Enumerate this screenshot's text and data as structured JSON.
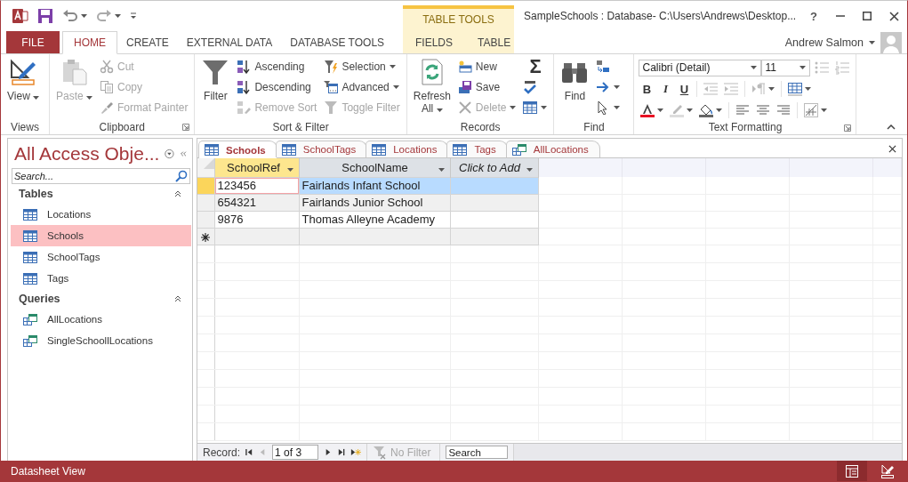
{
  "window": {
    "title": "SampleSchools : Database- C:\\Users\\Andrews\\Desktop...",
    "help": "?"
  },
  "contextual_group": {
    "label": "TABLE TOOLS"
  },
  "ribbon_tabs": [
    {
      "label": "FILE",
      "kind": "file",
      "selected": false
    },
    {
      "label": "HOME",
      "kind": "normal",
      "selected": true
    },
    {
      "label": "CREATE",
      "kind": "normal",
      "selected": false
    },
    {
      "label": "EXTERNAL DATA",
      "kind": "normal",
      "selected": false
    },
    {
      "label": "DATABASE TOOLS",
      "kind": "normal",
      "selected": false
    },
    {
      "label": "FIELDS",
      "kind": "contextual",
      "selected": false
    },
    {
      "label": "TABLE",
      "kind": "contextual",
      "selected": false
    }
  ],
  "account": {
    "name": "Andrew Salmon"
  },
  "ribbon": {
    "groups": [
      {
        "label": "Views",
        "commands": [
          {
            "label": "View",
            "disabled": false,
            "dropdown": true
          }
        ]
      },
      {
        "label": "Clipboard",
        "launcher": true,
        "commands": [
          {
            "label": "Paste",
            "disabled": true,
            "dropdown": true
          },
          {
            "label": "Cut",
            "disabled": true,
            "dropdown": false
          },
          {
            "label": "Copy",
            "disabled": true,
            "dropdown": false
          },
          {
            "label": "Format Painter",
            "disabled": true,
            "dropdown": false
          }
        ]
      },
      {
        "label": "Sort & Filter",
        "commands": [
          {
            "label": "Filter",
            "disabled": false,
            "dropdown": false
          },
          {
            "label": "Ascending",
            "disabled": false,
            "dropdown": false
          },
          {
            "label": "Descending",
            "disabled": false,
            "dropdown": false
          },
          {
            "label": "Remove Sort",
            "disabled": true,
            "dropdown": false
          },
          {
            "label": "Selection",
            "disabled": false,
            "dropdown": true
          },
          {
            "label": "Advanced",
            "disabled": false,
            "dropdown": true
          },
          {
            "label": "Toggle Filter",
            "disabled": true,
            "dropdown": false
          }
        ]
      },
      {
        "label": "Records",
        "totals": "Σ",
        "commands": [
          {
            "label": "Refresh All",
            "disabled": false,
            "dropdown": true
          },
          {
            "label": "New",
            "disabled": false,
            "dropdown": false
          },
          {
            "label": "Save",
            "disabled": false,
            "dropdown": false
          },
          {
            "label": "Delete",
            "disabled": true,
            "dropdown": true
          }
        ]
      },
      {
        "label": "Find",
        "commands": [
          {
            "label": "Find",
            "disabled": false,
            "dropdown": false
          }
        ]
      },
      {
        "label": "Text Formatting",
        "launcher": true,
        "font": "Calibri (Detail)",
        "size": "11",
        "styles": [
          "B",
          "I",
          "U"
        ]
      }
    ]
  },
  "nav_pane": {
    "title": "All Access Obje...",
    "search_placeholder": "Search...",
    "groups": [
      {
        "label": "Tables",
        "expanded": true,
        "items": [
          {
            "label": "Locations",
            "kind": "table",
            "selected": false
          },
          {
            "label": "Schools",
            "kind": "table",
            "selected": true
          },
          {
            "label": "SchoolTags",
            "kind": "table",
            "selected": false
          },
          {
            "label": "Tags",
            "kind": "table",
            "selected": false
          }
        ]
      },
      {
        "label": "Queries",
        "expanded": true,
        "items": [
          {
            "label": "AllLocations",
            "kind": "query",
            "selected": false
          },
          {
            "label": "SingleSchoollLocations",
            "kind": "query",
            "selected": false
          }
        ]
      }
    ]
  },
  "document_tabs": [
    {
      "label": "Schools",
      "kind": "table",
      "selected": true
    },
    {
      "label": "SchoolTags",
      "kind": "table",
      "selected": false
    },
    {
      "label": "Locations",
      "kind": "table",
      "selected": false
    },
    {
      "label": "Tags",
      "kind": "table",
      "selected": false
    },
    {
      "label": "AllLocations",
      "kind": "query",
      "selected": false
    }
  ],
  "datasheet": {
    "columns": [
      {
        "label": "SchoolRef",
        "kind": "field",
        "selected": true
      },
      {
        "label": "SchoolName",
        "kind": "field",
        "selected": false
      },
      {
        "label": "Click to Add",
        "kind": "add",
        "selected": false
      }
    ],
    "rows": [
      {
        "cells": [
          "123456",
          "Fairlands Infant School"
        ],
        "selected": true
      },
      {
        "cells": [
          "654321",
          "Fairlands Junior School"
        ],
        "selected": false
      },
      {
        "cells": [
          "9876",
          "Thomas Alleyne Academy"
        ],
        "selected": false
      }
    ]
  },
  "record_navigator": {
    "label": "Record:",
    "position": "1 of 3",
    "filter": {
      "label": "No Filter",
      "disabled": true
    },
    "search_placeholder": "Search"
  },
  "status_bar": {
    "text": "Datasheet View",
    "views": [
      {
        "kind": "datasheet",
        "selected": true
      },
      {
        "kind": "design",
        "selected": false
      }
    ]
  }
}
